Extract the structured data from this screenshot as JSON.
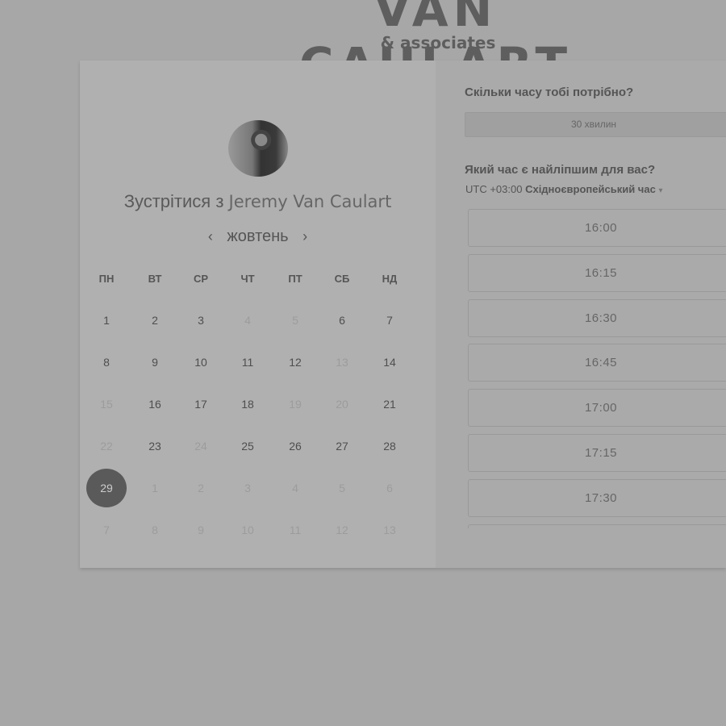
{
  "brand": {
    "name": "VAN CAULART",
    "tagline": "& associates"
  },
  "left": {
    "title_prefix": "Зустрітися з",
    "host": "Jeremy Van Caulart",
    "month": "жовтень",
    "prev_icon": "‹",
    "next_icon": "›",
    "weekdays": [
      "ПН",
      "ВТ",
      "СР",
      "ЧТ",
      "ПТ",
      "СБ",
      "НД"
    ],
    "days": [
      {
        "d": "1"
      },
      {
        "d": "2"
      },
      {
        "d": "3"
      },
      {
        "d": "4",
        "dim": true
      },
      {
        "d": "5",
        "dim": true
      },
      {
        "d": "6"
      },
      {
        "d": "7"
      },
      {
        "d": "8"
      },
      {
        "d": "9"
      },
      {
        "d": "10"
      },
      {
        "d": "11"
      },
      {
        "d": "12"
      },
      {
        "d": "13",
        "dim": true
      },
      {
        "d": "14"
      },
      {
        "d": "15",
        "dim": true
      },
      {
        "d": "16"
      },
      {
        "d": "17"
      },
      {
        "d": "18"
      },
      {
        "d": "19",
        "dim": true
      },
      {
        "d": "20",
        "dim": true
      },
      {
        "d": "21"
      },
      {
        "d": "22",
        "dim": true
      },
      {
        "d": "23"
      },
      {
        "d": "24",
        "dim": true
      },
      {
        "d": "25"
      },
      {
        "d": "26"
      },
      {
        "d": "27"
      },
      {
        "d": "28"
      },
      {
        "d": "29",
        "selected": true
      },
      {
        "d": "1",
        "dim": true
      },
      {
        "d": "2",
        "dim": true
      },
      {
        "d": "3",
        "dim": true
      },
      {
        "d": "4",
        "dim": true
      },
      {
        "d": "5",
        "dim": true
      },
      {
        "d": "6",
        "dim": true
      },
      {
        "d": "7",
        "dim": true
      },
      {
        "d": "8",
        "dim": true
      },
      {
        "d": "9",
        "dim": true
      },
      {
        "d": "10",
        "dim": true
      },
      {
        "d": "11",
        "dim": true
      },
      {
        "d": "12",
        "dim": true
      },
      {
        "d": "13",
        "dim": true
      }
    ]
  },
  "right": {
    "duration_question": "Скільки часу тобі потрібно?",
    "duration": "30 хвилин",
    "time_question": "Який час є найліпшим для вас?",
    "tz_offset": "UTC +03:00",
    "tz_name": "Східноєвропейський час",
    "tz_caret": "▾",
    "slots": [
      "16:00",
      "16:15",
      "16:30",
      "16:45",
      "17:00",
      "17:15",
      "17:30",
      ""
    ]
  },
  "colors": {
    "selected_day": "#5a5a5a",
    "overlay_bg": "#a7a7a7"
  }
}
